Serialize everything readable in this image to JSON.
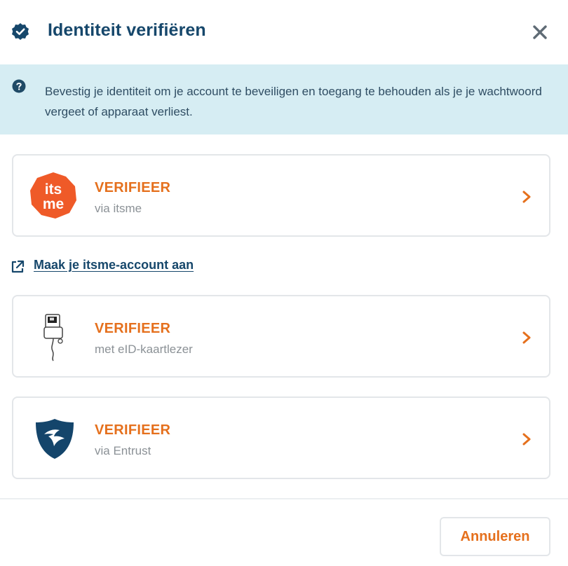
{
  "dialog": {
    "title": "Identiteit verifiëren",
    "close_icon": "close-icon",
    "title_icon": "shield-check-icon"
  },
  "info": {
    "icon": "question-circle-icon",
    "text": "Bevestig je identiteit om je account te beveiligen en toegang te behouden als je je wachtwoord vergeet of apparaat verliest."
  },
  "options": [
    {
      "logo_text_top": "its",
      "logo_text_bottom": "me",
      "title": "VERIFIEER",
      "subtitle": "via itsme"
    },
    {
      "title": "VERIFIEER",
      "subtitle": "met eID-kaartlezer",
      "icon": "card-reader-icon"
    },
    {
      "title": "VERIFIEER",
      "subtitle": "via Entrust",
      "icon": "entrust-shield-icon"
    }
  ],
  "link": {
    "label": "Maak je itsme-account aan",
    "icon": "external-link-icon"
  },
  "footer": {
    "cancel_label": "Annuleren"
  },
  "colors": {
    "accent": "#e5701d",
    "primary": "#16476b",
    "info_bg": "#d6edf3",
    "itsme": "#ef5a28",
    "entrust": "#14456b"
  }
}
